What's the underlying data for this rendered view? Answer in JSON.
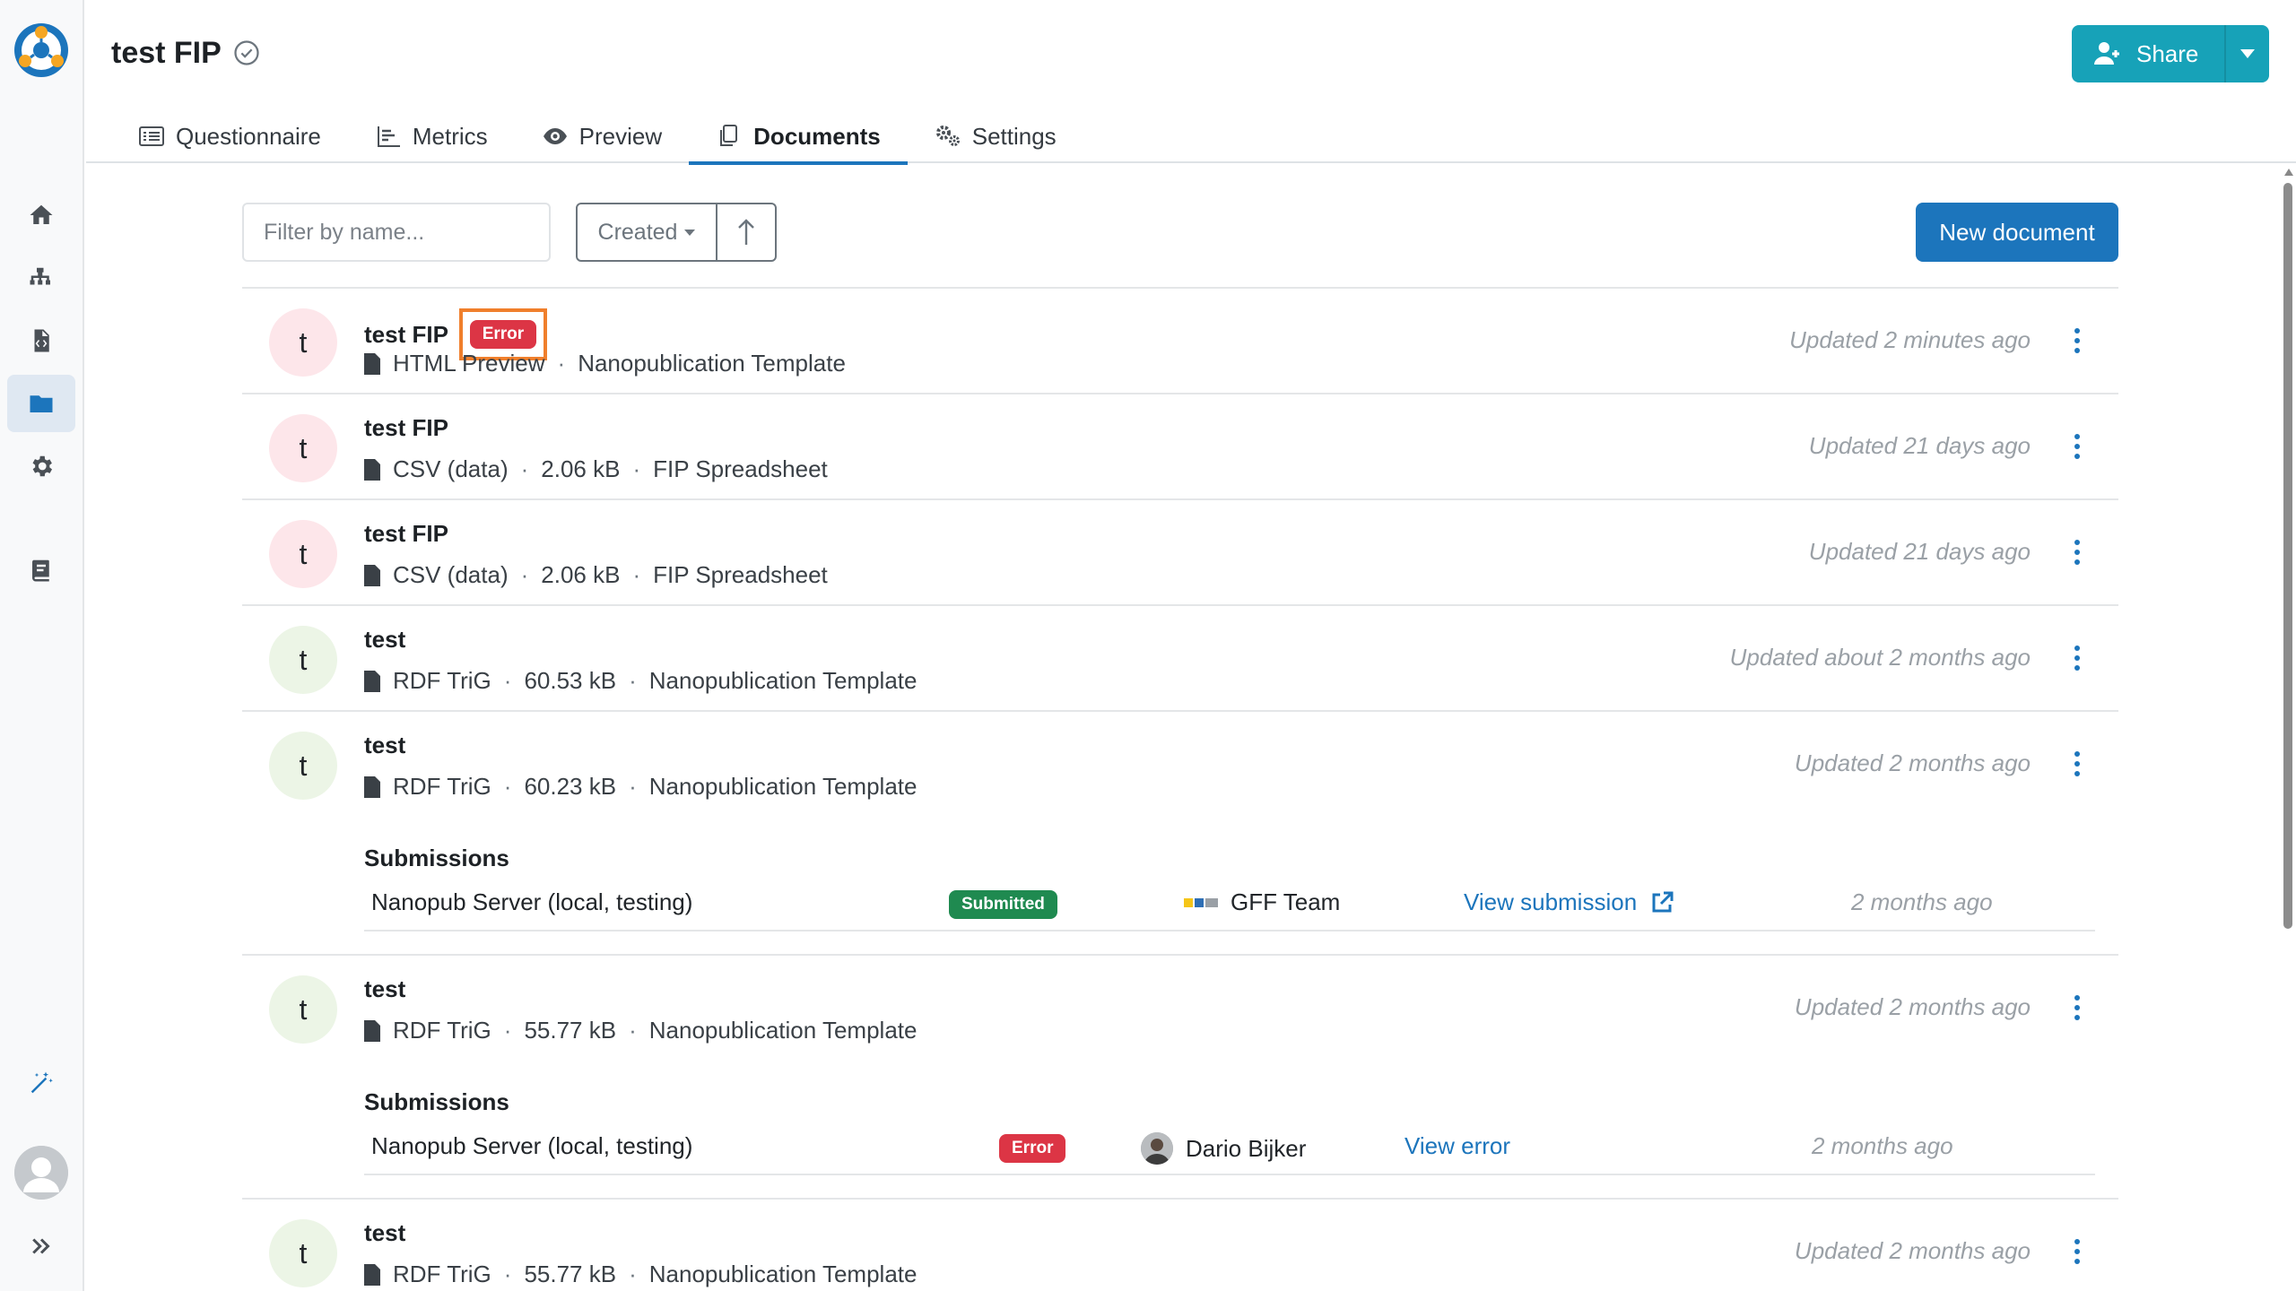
{
  "project": {
    "title": "test FIP",
    "share_label": "Share"
  },
  "tabs": [
    {
      "label": "Questionnaire",
      "icon": "list-icon"
    },
    {
      "label": "Metrics",
      "icon": "chart-icon"
    },
    {
      "label": "Preview",
      "icon": "eye-icon"
    },
    {
      "label": "Documents",
      "icon": "documents-icon",
      "active": true
    },
    {
      "label": "Settings",
      "icon": "cogs-icon"
    }
  ],
  "toolbar": {
    "filter_placeholder": "Filter by name...",
    "sort_label": "Created",
    "new_document_label": "New document"
  },
  "documents": [
    {
      "avatar": "t",
      "title": "test FIP",
      "status_badge": "Error",
      "format": "HTML Preview",
      "size": "",
      "template": "Nanopublication Template",
      "updated": "Updated 2 minutes ago"
    },
    {
      "avatar": "t",
      "title": "test FIP",
      "format": "CSV (data)",
      "size": "2.06 kB",
      "template": "FIP Spreadsheet",
      "updated": "Updated 21 days ago"
    },
    {
      "avatar": "t",
      "title": "test FIP",
      "format": "CSV (data)",
      "size": "2.06 kB",
      "template": "FIP Spreadsheet",
      "updated": "Updated 21 days ago"
    },
    {
      "avatar": "t",
      "title": "test",
      "format": "RDF TriG",
      "size": "60.53 kB",
      "template": "Nanopublication Template",
      "updated": "Updated about 2 months ago"
    },
    {
      "avatar": "t",
      "title": "test",
      "format": "RDF TriG",
      "size": "60.23 kB",
      "template": "Nanopublication Template",
      "updated": "Updated 2 months ago",
      "submissions_title": "Submissions",
      "submission": {
        "service": "Nanopub Server (local, testing)",
        "status": "Submitted",
        "user": "GFF Team",
        "link": "View submission",
        "time": "2 months ago"
      }
    },
    {
      "avatar": "t",
      "title": "test",
      "format": "RDF TriG",
      "size": "55.77 kB",
      "template": "Nanopublication Template",
      "updated": "Updated 2 months ago",
      "submissions_title": "Submissions",
      "submission": {
        "service": "Nanopub Server (local, testing)",
        "status": "Error",
        "user": "Dario Bijker",
        "link": "View error",
        "time": "2 months ago"
      }
    },
    {
      "avatar": "t",
      "title": "test",
      "format": "RDF TriG",
      "size": "55.77 kB",
      "template": "Nanopublication Template",
      "updated": "Updated 2 months ago"
    }
  ],
  "colors": {
    "primary": "#1c75bc",
    "share": "#17a2b8",
    "error": "#dc3545",
    "success": "#1f8a50",
    "highlight": "#f07f2c"
  }
}
